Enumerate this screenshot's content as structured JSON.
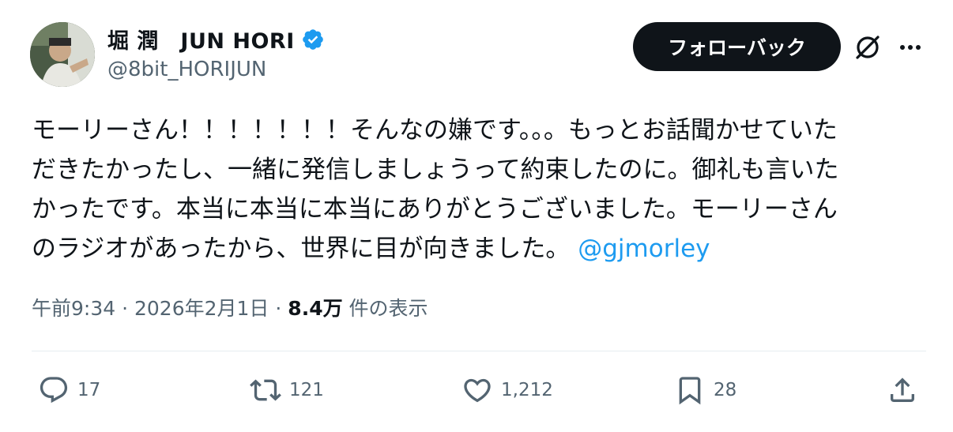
{
  "author": {
    "display_name": "堀 潤　JUN HORI",
    "handle": "@8bit_HORIJUN"
  },
  "follow_button_label": "フォローバック",
  "tweet": {
    "text_lines": [
      "モーリーさん！！！！！！！そんなの嫌です。。。もっとお話聞かせていた",
      "だきたかったし、一緒に発信しましょうって約束したのに。御礼も言いた",
      "かったです。本当に本当に本当にありがとうございました。モーリーさん",
      "のラジオがあったから、世界に目が向きました。"
    ],
    "mention": "@gjmorley"
  },
  "meta": {
    "time": "午前9:34",
    "separator": "·",
    "date": "2026年2月1日",
    "views_count": "8.4万",
    "views_label": "件の表示"
  },
  "actions": {
    "reply_count": "17",
    "retweet_count": "121",
    "like_count": "1,212",
    "bookmark_count": "28"
  },
  "colors": {
    "text": "#0f1419",
    "secondary": "#536471",
    "accent": "#1d9bf0",
    "button_bg": "#0f1419"
  },
  "icons": [
    "verified-badge-icon",
    "grok-icon",
    "more-icon",
    "reply-icon",
    "retweet-icon",
    "like-icon",
    "bookmark-icon",
    "share-icon"
  ]
}
